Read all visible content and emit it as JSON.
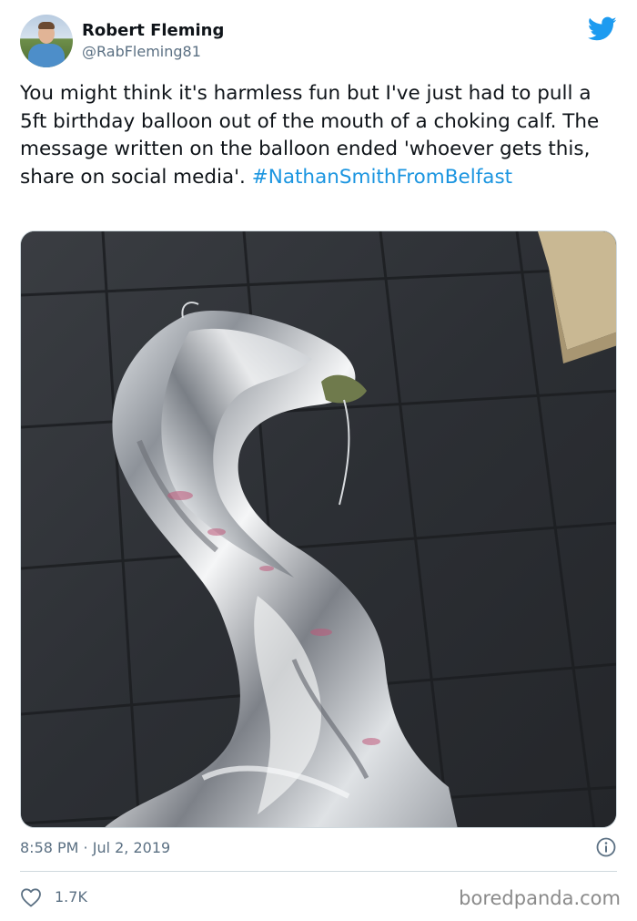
{
  "author": {
    "name": "Robert Fleming",
    "handle": "@RabFleming81",
    "avatar_icon": "user-avatar"
  },
  "platform_icon": "twitter-bird-icon",
  "tweet": {
    "text": "You might think it's harmless fun but I've just had to pull a 5ft birthday balloon out of the mouth of a choking calf. The message written on the balloon ended 'whoever gets this, share on social media'.",
    "hashtag": "#NathanSmithFromBelfast"
  },
  "photo": {
    "subject": "silver foil balloon on dark tiled floor"
  },
  "meta": {
    "timestamp": "8:58 PM · Jul 2, 2019",
    "info_icon": "info-icon"
  },
  "engagement": {
    "likes": "1.7K",
    "like_icon": "heart-icon"
  },
  "watermark": "boredpanda.com",
  "colors": {
    "accent": "#1b95e0",
    "secondary_text": "#5b7083",
    "primary_text": "#0f1419"
  }
}
